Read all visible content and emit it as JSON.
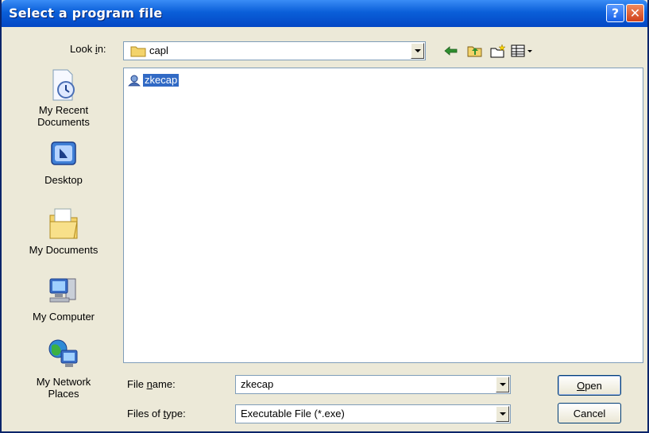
{
  "window": {
    "title": "Select a program file",
    "help_label": "?",
    "close_label": "✕"
  },
  "look_in": {
    "label_prefix": "Look ",
    "label_u": "i",
    "label_suffix": "n:",
    "value": "capl"
  },
  "toolbar": {
    "icons": [
      "back-arrow-icon",
      "up-folder-icon",
      "new-folder-icon",
      "view-menu-icon"
    ]
  },
  "places": [
    {
      "id": "recent",
      "label": "My Recent Documents",
      "line1": "My Recent",
      "line2": "Documents",
      "icon": "recent-documents-icon"
    },
    {
      "id": "desktop",
      "label": "Desktop",
      "line1": "Desktop",
      "line2": "",
      "icon": "desktop-icon"
    },
    {
      "id": "my-documents",
      "label": "My Documents",
      "line1": "My Documents",
      "line2": "",
      "icon": "my-documents-icon"
    },
    {
      "id": "my-computer",
      "label": "My Computer",
      "line1": "My Computer",
      "line2": "",
      "icon": "my-computer-icon"
    },
    {
      "id": "network",
      "label": "My Network Places",
      "line1": "My Network",
      "line2": "Places",
      "icon": "network-places-icon"
    }
  ],
  "files": [
    {
      "name": "zkecap",
      "icon": "program-icon",
      "selected": true
    }
  ],
  "file_name": {
    "label_prefix": "File ",
    "label_u": "n",
    "label_suffix": "ame:",
    "value": "zkecap"
  },
  "file_type": {
    "label_prefix": "Files of ",
    "label_u": "t",
    "label_suffix": "ype:",
    "value": "Executable File (*.exe)"
  },
  "buttons": {
    "open_u": "O",
    "open_rest": "pen",
    "cancel": "Cancel"
  },
  "colors": {
    "title_bar": "#0a5fd8",
    "selection": "#316ac5",
    "face": "#ece9d8"
  }
}
